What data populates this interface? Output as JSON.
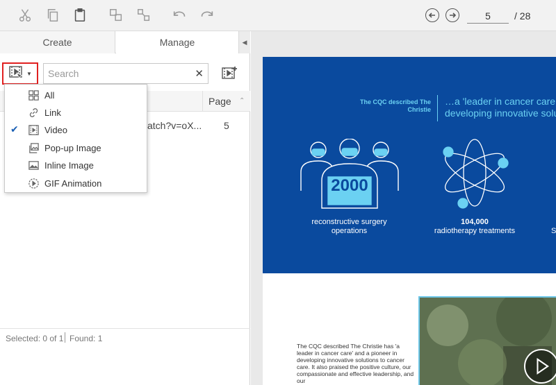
{
  "toolbar": {
    "icons": [
      "cut-icon",
      "copy-icon",
      "paste-icon",
      "group-icon",
      "ungroup-icon",
      "undo-icon",
      "redo-icon"
    ],
    "current_page": "5",
    "total_pages": "/ 28"
  },
  "left_panel": {
    "tabs": {
      "create": "Create",
      "manage": "Manage"
    },
    "search": {
      "placeholder": "Search",
      "value": ""
    },
    "list": {
      "header_page": "Page",
      "rows": [
        {
          "url": "atch?v=oX...",
          "page": "5"
        }
      ]
    },
    "status": {
      "selected": "Selected: 0 of 1",
      "found": "Found: 1"
    }
  },
  "filter_menu": {
    "items": [
      {
        "label": "All",
        "icon": "grid-icon",
        "checked": false
      },
      {
        "label": "Link",
        "icon": "link-icon",
        "checked": false
      },
      {
        "label": "Video",
        "icon": "video-icon",
        "checked": true
      },
      {
        "label": "Pop-up Image",
        "icon": "popup-image-icon",
        "checked": false
      },
      {
        "label": "Inline Image",
        "icon": "inline-image-icon",
        "checked": false
      },
      {
        "label": "GIF Animation",
        "icon": "gif-icon",
        "checked": false
      }
    ]
  },
  "document": {
    "cqc_label": "The CQC described The Christie",
    "quote_line1": "…a 'leader in cancer care",
    "quote_line2": "developing innovative solu",
    "stat1_number": "2000",
    "stat1_caption": "reconstructive surgery operations",
    "stat2_number": "104,000",
    "stat2_caption": "radiotherapy treatments",
    "stat3_caption": "S",
    "body_text": "The CQC described The Christie has 'a leader in cancer care' and a pioneer in developing innovative solutions to cancer care. It also praised the positive culture, our compassionate and effective leadership, and our",
    "colors": {
      "banner": "#0a4a9e",
      "accent": "#6bd1f2"
    }
  },
  "colors": {
    "highlight_border": "#e02020",
    "checkmark": "#1a5fb4"
  }
}
